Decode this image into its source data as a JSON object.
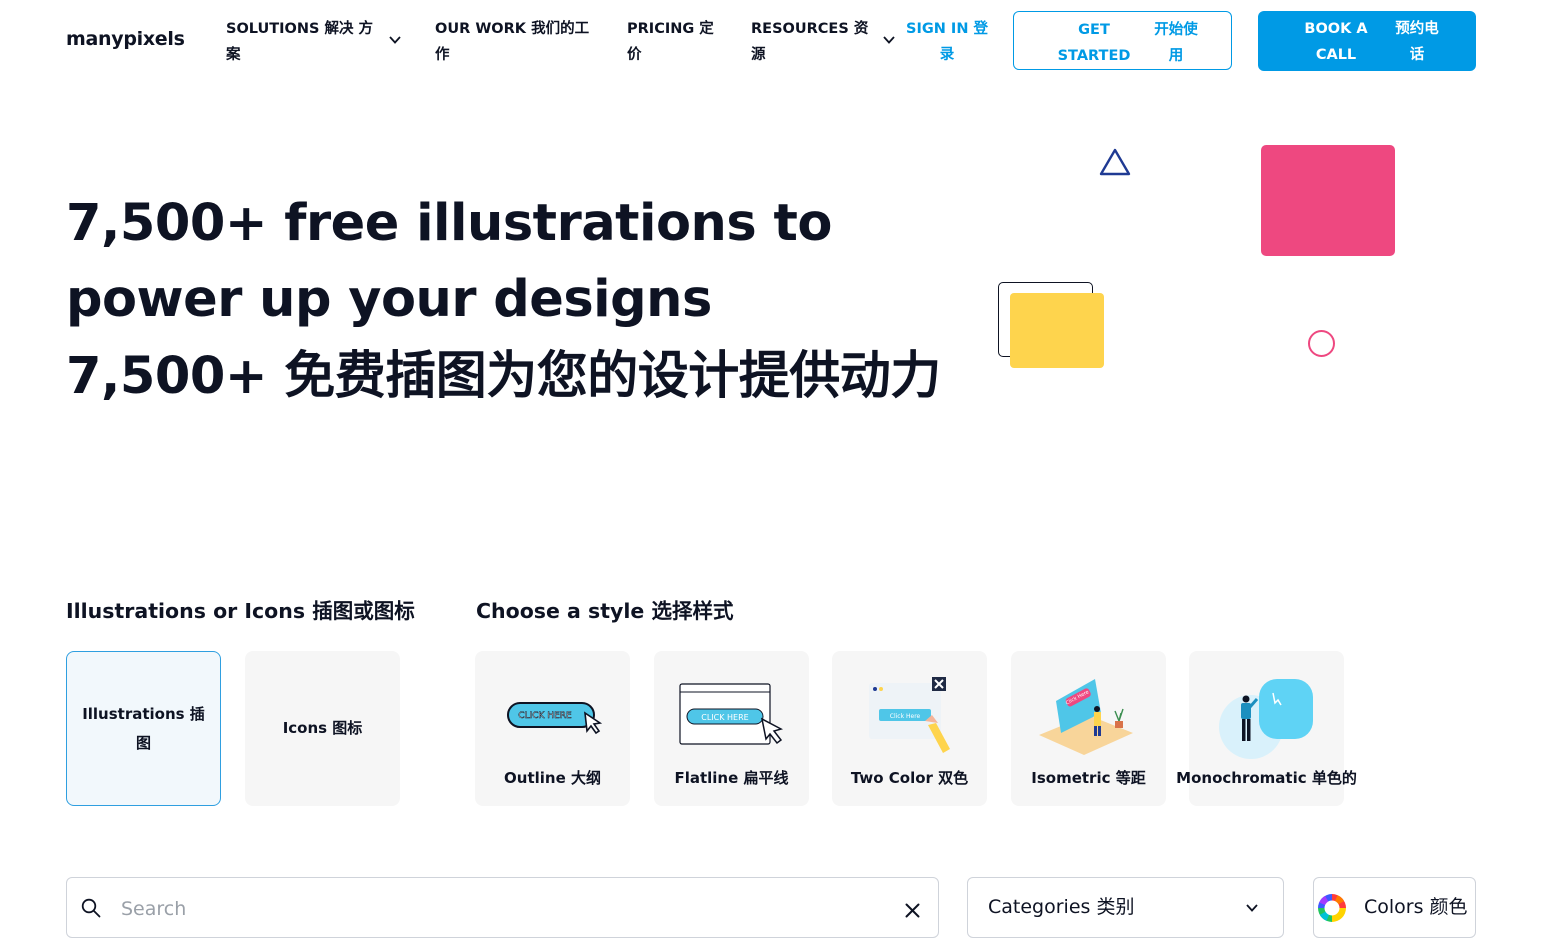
{
  "header": {
    "logo": "manypixels",
    "nav": [
      {
        "label": "SOLUTIONS 解决 方案"
      },
      {
        "label": "OUR WORK 我们的工作"
      },
      {
        "label": "PRICING 定价"
      },
      {
        "label": "RESOURCES 资源"
      }
    ],
    "sign_in": "SIGN IN 登录",
    "get_started": {
      "en": "GET STARTED",
      "zh": "开始使用"
    },
    "book_call": {
      "en": "BOOK A CALL",
      "zh": "预约电话"
    }
  },
  "hero": {
    "title_en": "7,500+ free illustrations to power up your designs",
    "title_zh": "7,500+ 免费插图为您的设计提供动力"
  },
  "type_section": {
    "label": "Illustrations or Icons 插图或图标",
    "options": [
      {
        "label": "Illustrations 插图",
        "selected": true
      },
      {
        "label": "Icons 图标",
        "selected": false
      }
    ]
  },
  "style_section": {
    "label": "Choose a style 选择样式",
    "options": [
      {
        "label": "Outline 大纲",
        "thumb_text": "CLICK HERE"
      },
      {
        "label": "Flatline 扁平线",
        "thumb_text": "CLICK HERE"
      },
      {
        "label": "Two Color 双色",
        "thumb_text": "Click Here"
      },
      {
        "label": "Isometric 等距",
        "thumb_text": "Click Here"
      },
      {
        "label": "Monochromatic 单色的"
      }
    ]
  },
  "filters": {
    "search_placeholder": "Search",
    "search_value": "",
    "categories_label": "Categories 类别",
    "colors_label": "Colors 颜色"
  },
  "colors": {
    "accent": "#009ae5",
    "text": "#0e1323",
    "deco_pink": "#ee4880",
    "deco_yellow": "#fed44d",
    "deco_navy": "#1f3a93"
  },
  "icons": [
    "chevron-down-icon",
    "search-icon",
    "close-icon",
    "color-wheel-icon"
  ]
}
